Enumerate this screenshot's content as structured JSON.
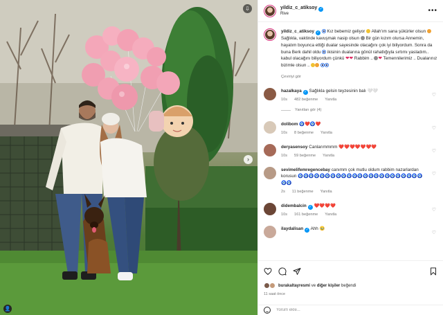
{
  "post": {
    "author": "yildiz_c_atiksoy",
    "subtitle": "Rive",
    "more_icon": "more-horizontal-icon",
    "caption": {
      "username": "yildiz_c_atiksoy",
      "part1": "Kız bebemiz geliyor",
      "part2": "Allah'ım sana şükürler olsun",
      "part3": "Sağlıkla, vaktinde kavuşmak nasip olsun",
      "part4": "Bir gün kızım olursa Annemin, hayatım boyunca ettiği dualar sayesinde olacağını çok iyi biliyordum. Sonra da buna Berk dahil oldu",
      "part5": "ikisinin dualarına gönül rahatlığıyla sırtımı yasladım.. kabul olacağını biliyordum çünkü",
      "part6": "Rabbim ..",
      "part7": "Temennilerimiz .. Dualarınız bizimle olsun ..",
      "translate": "Çeviriyi gör"
    },
    "liked_by_prefix": "",
    "liked_by_user": "burakaltayresmi",
    "liked_by_mid": " ve ",
    "liked_by_others": "diğer kişiler",
    "liked_by_suffix": " beğendi",
    "time_ago": "11 saat önce",
    "comment_placeholder": "Yorum ekle..."
  },
  "comments": [
    {
      "user": "hazalkaya",
      "verified": true,
      "text": "Sağlıkla gelsin teyzesinin balı 🤍🤍",
      "time": "10s",
      "likes": "482 beğenme",
      "reply": "Yanıtla",
      "view_replies": "Yanıtları gör (4)",
      "avatar_color": "#8a5a44"
    },
    {
      "user": "dolibom",
      "verified": false,
      "text": "🧿❤️🧿❤️",
      "time": "10s",
      "likes": "8 beğenme",
      "reply": "Yanıtla",
      "avatar_color": "#d8c9b8"
    },
    {
      "user": "deryasensoy",
      "verified": false,
      "text": "Canlarımmmm ❤️❤️❤️❤️❤️❤️❤️",
      "time": "10s",
      "likes": "59 beğenme",
      "reply": "Yanıtla",
      "avatar_color": "#a66a58"
    },
    {
      "user": "sevimelifemregencebay",
      "verified": false,
      "text": "canımm çok mutlu oldum rabbim nazarlardan korusun 🧿🧿🧿🧿🧿🧿🧿🧿🧿🧿🧿🧿🧿🧿🧿🧿🧿🧿🧿🧿🧿🧿🧿🧿🧿",
      "time": "2s",
      "likes": "11 beğenme",
      "reply": "Yanıtla",
      "avatar_color": "#b79a86"
    },
    {
      "user": "didembalcin",
      "verified": true,
      "text": "❤️❤️❤️❤️",
      "time": "10s",
      "likes": "161 beğenme",
      "reply": "Yanıtla",
      "avatar_color": "#6b4636"
    },
    {
      "user": "ilaydalisan",
      "verified": true,
      "text": "Ahh 🥹",
      "time": "",
      "likes": "",
      "reply": "",
      "avatar_color": "#c9a99a"
    }
  ],
  "colors": {
    "verified": "#0095f6",
    "heart": "#e0245e",
    "muted": "#737373",
    "balloon": "#f3a4b7"
  },
  "icons": [
    "heart-icon",
    "comment-icon",
    "share-icon",
    "bookmark-icon",
    "emoji-icon",
    "chevron-right-icon",
    "user-tag-icon",
    "save-icon"
  ]
}
